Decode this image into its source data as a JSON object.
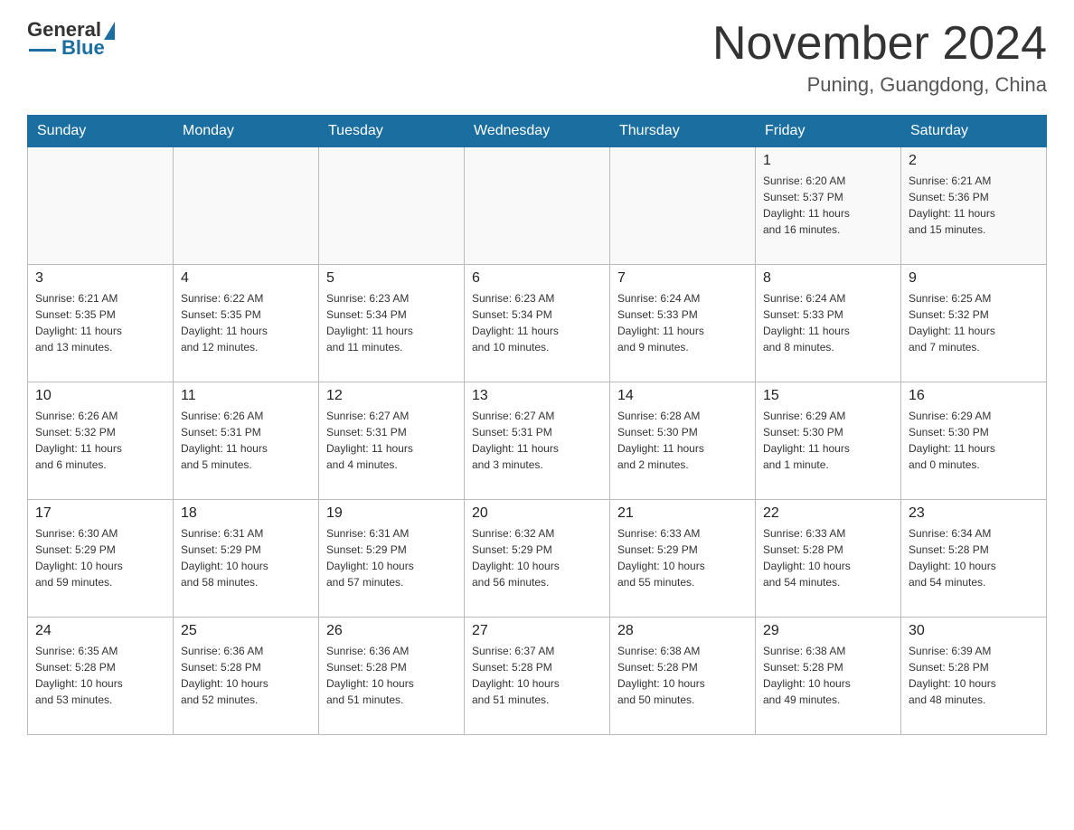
{
  "header": {
    "logo": {
      "general": "General",
      "blue": "Blue"
    },
    "title": "November 2024",
    "location": "Puning, Guangdong, China"
  },
  "weekdays": [
    "Sunday",
    "Monday",
    "Tuesday",
    "Wednesday",
    "Thursday",
    "Friday",
    "Saturday"
  ],
  "weeks": [
    [
      {
        "day": "",
        "info": ""
      },
      {
        "day": "",
        "info": ""
      },
      {
        "day": "",
        "info": ""
      },
      {
        "day": "",
        "info": ""
      },
      {
        "day": "",
        "info": ""
      },
      {
        "day": "1",
        "info": "Sunrise: 6:20 AM\nSunset: 5:37 PM\nDaylight: 11 hours\nand 16 minutes."
      },
      {
        "day": "2",
        "info": "Sunrise: 6:21 AM\nSunset: 5:36 PM\nDaylight: 11 hours\nand 15 minutes."
      }
    ],
    [
      {
        "day": "3",
        "info": "Sunrise: 6:21 AM\nSunset: 5:35 PM\nDaylight: 11 hours\nand 13 minutes."
      },
      {
        "day": "4",
        "info": "Sunrise: 6:22 AM\nSunset: 5:35 PM\nDaylight: 11 hours\nand 12 minutes."
      },
      {
        "day": "5",
        "info": "Sunrise: 6:23 AM\nSunset: 5:34 PM\nDaylight: 11 hours\nand 11 minutes."
      },
      {
        "day": "6",
        "info": "Sunrise: 6:23 AM\nSunset: 5:34 PM\nDaylight: 11 hours\nand 10 minutes."
      },
      {
        "day": "7",
        "info": "Sunrise: 6:24 AM\nSunset: 5:33 PM\nDaylight: 11 hours\nand 9 minutes."
      },
      {
        "day": "8",
        "info": "Sunrise: 6:24 AM\nSunset: 5:33 PM\nDaylight: 11 hours\nand 8 minutes."
      },
      {
        "day": "9",
        "info": "Sunrise: 6:25 AM\nSunset: 5:32 PM\nDaylight: 11 hours\nand 7 minutes."
      }
    ],
    [
      {
        "day": "10",
        "info": "Sunrise: 6:26 AM\nSunset: 5:32 PM\nDaylight: 11 hours\nand 6 minutes."
      },
      {
        "day": "11",
        "info": "Sunrise: 6:26 AM\nSunset: 5:31 PM\nDaylight: 11 hours\nand 5 minutes."
      },
      {
        "day": "12",
        "info": "Sunrise: 6:27 AM\nSunset: 5:31 PM\nDaylight: 11 hours\nand 4 minutes."
      },
      {
        "day": "13",
        "info": "Sunrise: 6:27 AM\nSunset: 5:31 PM\nDaylight: 11 hours\nand 3 minutes."
      },
      {
        "day": "14",
        "info": "Sunrise: 6:28 AM\nSunset: 5:30 PM\nDaylight: 11 hours\nand 2 minutes."
      },
      {
        "day": "15",
        "info": "Sunrise: 6:29 AM\nSunset: 5:30 PM\nDaylight: 11 hours\nand 1 minute."
      },
      {
        "day": "16",
        "info": "Sunrise: 6:29 AM\nSunset: 5:30 PM\nDaylight: 11 hours\nand 0 minutes."
      }
    ],
    [
      {
        "day": "17",
        "info": "Sunrise: 6:30 AM\nSunset: 5:29 PM\nDaylight: 10 hours\nand 59 minutes."
      },
      {
        "day": "18",
        "info": "Sunrise: 6:31 AM\nSunset: 5:29 PM\nDaylight: 10 hours\nand 58 minutes."
      },
      {
        "day": "19",
        "info": "Sunrise: 6:31 AM\nSunset: 5:29 PM\nDaylight: 10 hours\nand 57 minutes."
      },
      {
        "day": "20",
        "info": "Sunrise: 6:32 AM\nSunset: 5:29 PM\nDaylight: 10 hours\nand 56 minutes."
      },
      {
        "day": "21",
        "info": "Sunrise: 6:33 AM\nSunset: 5:29 PM\nDaylight: 10 hours\nand 55 minutes."
      },
      {
        "day": "22",
        "info": "Sunrise: 6:33 AM\nSunset: 5:28 PM\nDaylight: 10 hours\nand 54 minutes."
      },
      {
        "day": "23",
        "info": "Sunrise: 6:34 AM\nSunset: 5:28 PM\nDaylight: 10 hours\nand 54 minutes."
      }
    ],
    [
      {
        "day": "24",
        "info": "Sunrise: 6:35 AM\nSunset: 5:28 PM\nDaylight: 10 hours\nand 53 minutes."
      },
      {
        "day": "25",
        "info": "Sunrise: 6:36 AM\nSunset: 5:28 PM\nDaylight: 10 hours\nand 52 minutes."
      },
      {
        "day": "26",
        "info": "Sunrise: 6:36 AM\nSunset: 5:28 PM\nDaylight: 10 hours\nand 51 minutes."
      },
      {
        "day": "27",
        "info": "Sunrise: 6:37 AM\nSunset: 5:28 PM\nDaylight: 10 hours\nand 51 minutes."
      },
      {
        "day": "28",
        "info": "Sunrise: 6:38 AM\nSunset: 5:28 PM\nDaylight: 10 hours\nand 50 minutes."
      },
      {
        "day": "29",
        "info": "Sunrise: 6:38 AM\nSunset: 5:28 PM\nDaylight: 10 hours\nand 49 minutes."
      },
      {
        "day": "30",
        "info": "Sunrise: 6:39 AM\nSunset: 5:28 PM\nDaylight: 10 hours\nand 48 minutes."
      }
    ]
  ]
}
